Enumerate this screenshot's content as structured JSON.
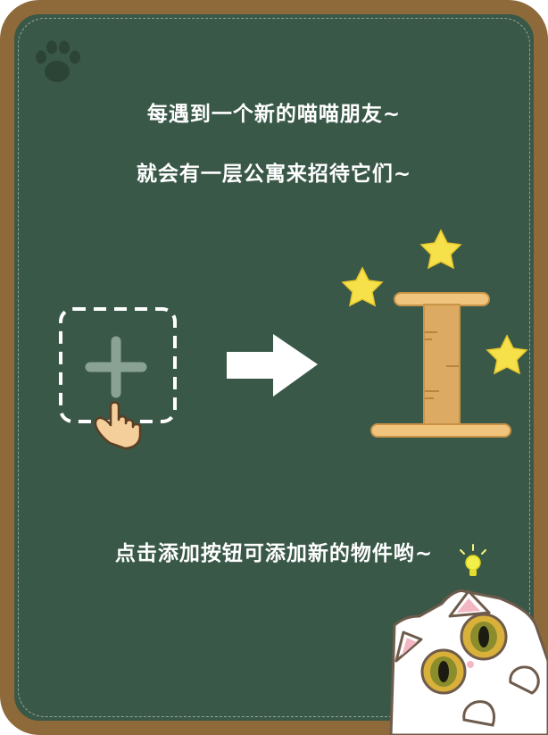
{
  "texts": {
    "line1": "每遇到一个新的喵喵朋友~",
    "line2": "就会有一层公寓来招待它们~",
    "line3": "点击添加按钮可添加新的物件哟~"
  },
  "icons": {
    "paw": "paw-icon",
    "add": "plus-icon",
    "pointer": "hand-pointer-icon",
    "arrow": "arrow-right-icon",
    "star": "star-icon",
    "post": "scratching-post-icon",
    "bulb": "lightbulb-icon",
    "cat": "cat-mascot"
  },
  "colors": {
    "board": "#3a5848",
    "frame": "#8e6a3a",
    "text": "#ffffff",
    "star": "#f7e14a",
    "post": "#e3b46c",
    "plus": "#8aa293"
  }
}
